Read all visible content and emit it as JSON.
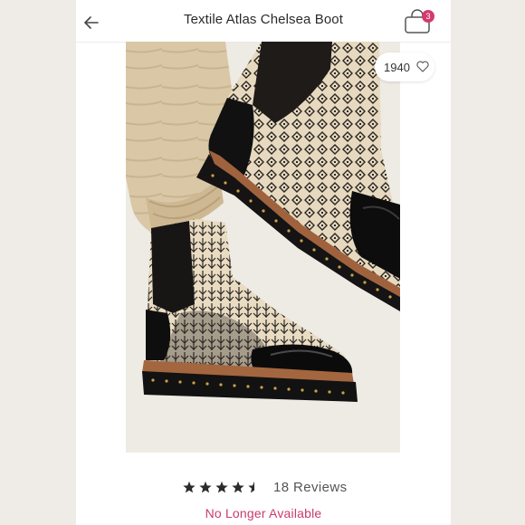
{
  "header": {
    "title": "Textile Atlas Chelsea Boot",
    "back_icon": "arrow-left-icon",
    "bag_icon": "shopping-bag-icon",
    "bag_count": "3",
    "badge_color": "#d43a6e"
  },
  "listing": {
    "like_count": "1940",
    "like_icon": "heart-outline-icon",
    "rating_value": 4.5,
    "rating_max": 5,
    "reviews_label": "18 Reviews",
    "availability": "No Longer Available",
    "availability_color": "#c93a6f"
  }
}
